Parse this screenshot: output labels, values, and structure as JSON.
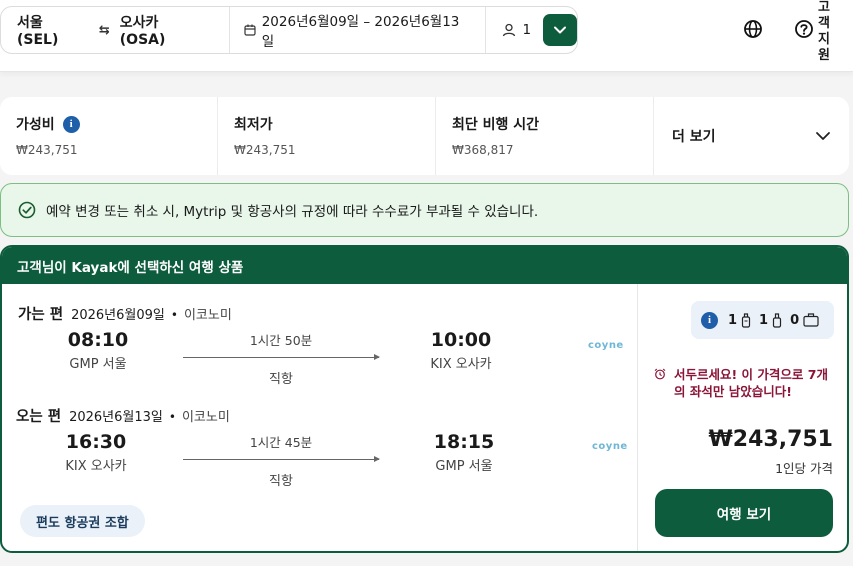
{
  "search": {
    "origin": "서울 (SEL)",
    "destination": "오사카 (OSA)",
    "dates": "2026년6월09일 – 2026년6월13일",
    "passengers": "1"
  },
  "header": {
    "support_label": "고객지원"
  },
  "sort_tabs": [
    {
      "label": "가성비",
      "price": "₩243,751"
    },
    {
      "label": "최저가",
      "price": "₩243,751"
    },
    {
      "label": "최단 비행 시간",
      "price": "₩368,817"
    }
  ],
  "more_label": "더 보기",
  "notice": "예약 변경 또는 취소 시, Mytrip 및 항공사의 규정에 따라 수수료가 부과될 수 있습니다.",
  "card": {
    "header": "고객님이 Kayak에 선택하신 여행 상품",
    "outbound": {
      "direction": "가는 편",
      "date": "2026년6월09일",
      "cabin": "이코노미",
      "dep_time": "08:10",
      "dep_place": "GMP 서울",
      "duration": "1시간 50분",
      "stops": "직항",
      "arr_time": "10:00",
      "arr_place": "KIX 오사카",
      "airline": "coyne"
    },
    "return": {
      "direction": "오는 편",
      "date": "2026년6월13일",
      "cabin": "이코노미",
      "dep_time": "16:30",
      "dep_place": "KIX 오사카",
      "duration": "1시간 45분",
      "stops": "직항",
      "arr_time": "18:15",
      "arr_place": "GMP 서울",
      "airline": "coyne"
    },
    "combo_badge": "편도 항공권 조합",
    "bags": {
      "personal": "1",
      "carry_on": "1",
      "checked": "0"
    },
    "urgency": "서두르세요! 이 가격으로 7개의 좌석만 남았습니다!",
    "price": "₩243,751",
    "per_person": "1인당 가격",
    "view_button": "여행 보기"
  },
  "colors": {
    "brand_green": "#0d5c3e",
    "info_blue": "#1f5ea8",
    "urgency_red": "#8a1538",
    "notice_bg": "#e9f6ea"
  }
}
